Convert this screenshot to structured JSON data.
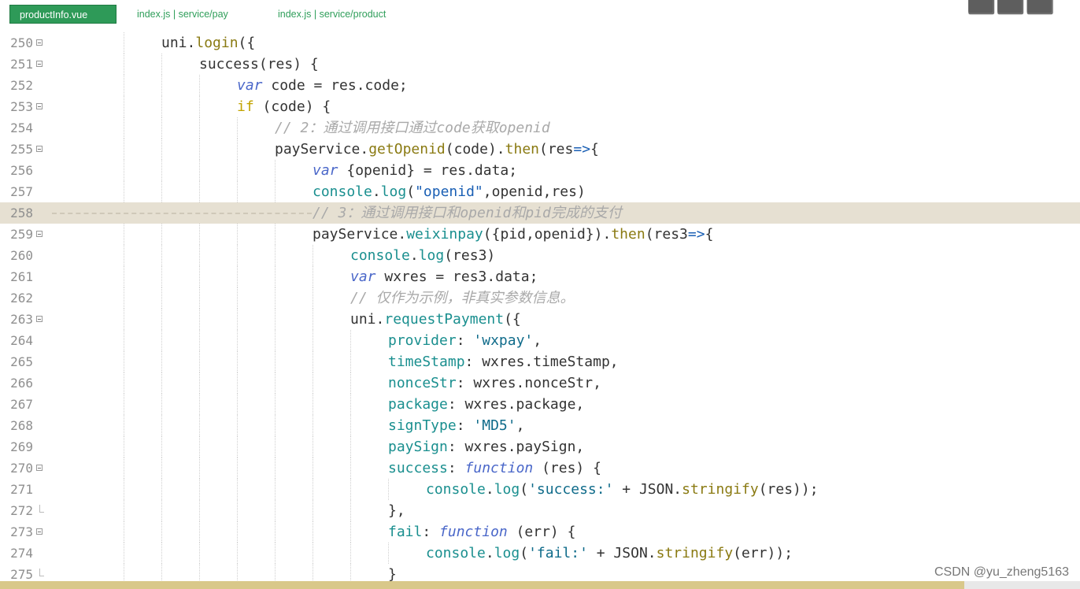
{
  "tabs": [
    {
      "label": "productInfo.vue",
      "active": true
    },
    {
      "label": "index.js | service/pay",
      "active": false
    },
    {
      "label": "index.js | service/product",
      "active": false
    }
  ],
  "watermark": "CSDN @yu_zheng5163",
  "colors": {
    "tab_active": "#2e9a58",
    "highlight_line": "#e6e0d2",
    "keyword": "#4a67c9",
    "property": "#1a8f8f",
    "comment": "#a9a9a9"
  },
  "lines": [
    {
      "n": "250",
      "fold": "open"
    },
    {
      "n": "251",
      "fold": "open"
    },
    {
      "n": "252",
      "fold": "none"
    },
    {
      "n": "253",
      "fold": "open"
    },
    {
      "n": "254",
      "fold": "none"
    },
    {
      "n": "255",
      "fold": "open"
    },
    {
      "n": "256",
      "fold": "none"
    },
    {
      "n": "257",
      "fold": "none"
    },
    {
      "n": "258",
      "fold": "none",
      "highlight": true
    },
    {
      "n": "259",
      "fold": "open"
    },
    {
      "n": "260",
      "fold": "none"
    },
    {
      "n": "261",
      "fold": "none"
    },
    {
      "n": "262",
      "fold": "none"
    },
    {
      "n": "263",
      "fold": "open"
    },
    {
      "n": "264",
      "fold": "none"
    },
    {
      "n": "265",
      "fold": "none"
    },
    {
      "n": "266",
      "fold": "none"
    },
    {
      "n": "267",
      "fold": "none"
    },
    {
      "n": "268",
      "fold": "none"
    },
    {
      "n": "269",
      "fold": "none"
    },
    {
      "n": "270",
      "fold": "open"
    },
    {
      "n": "271",
      "fold": "none"
    },
    {
      "n": "272",
      "fold": "end"
    },
    {
      "n": "273",
      "fold": "open"
    },
    {
      "n": "274",
      "fold": "none"
    },
    {
      "n": "275",
      "fold": "end"
    }
  ],
  "code": {
    "l250": [
      [
        "uni",
        "id"
      ],
      [
        ".",
        "punc"
      ],
      [
        "login",
        "fn"
      ],
      [
        "({",
        "punc"
      ]
    ],
    "l251": [
      [
        "success",
        "id"
      ],
      [
        "(res) {",
        "punc"
      ]
    ],
    "l252": [
      [
        "var",
        "kw"
      ],
      [
        " code = res.code;",
        "id"
      ]
    ],
    "l253": [
      [
        "if",
        "kw2"
      ],
      [
        " (code) {",
        "id"
      ]
    ],
    "l254": [
      [
        "// 2：通过调用接口通过code获取openid",
        "cmt"
      ]
    ],
    "l255": [
      [
        "payService",
        "id"
      ],
      [
        ".",
        "punc"
      ],
      [
        "getOpenid",
        "fn"
      ],
      [
        "(code)",
        "id"
      ],
      [
        ".",
        "punc"
      ],
      [
        "then",
        "fn"
      ],
      [
        "(res",
        "id"
      ],
      [
        "=>",
        "op"
      ],
      [
        "{",
        "id"
      ]
    ],
    "l256": [
      [
        "var",
        "kw"
      ],
      [
        " {openid} = res.data;",
        "id"
      ]
    ],
    "l257": [
      [
        "console",
        "prop"
      ],
      [
        ".",
        "punc"
      ],
      [
        "log",
        "prop"
      ],
      [
        "(",
        "id"
      ],
      [
        "\"openid\"",
        "str"
      ],
      [
        ",openid,res)",
        "id"
      ]
    ],
    "l258": [
      [
        "// 3：通过调用接口和openid和pid完成的支付",
        "cmt"
      ]
    ],
    "l259": [
      [
        "payService",
        "id"
      ],
      [
        ".",
        "punc"
      ],
      [
        "weixinpay",
        "prop"
      ],
      [
        "({pid,openid})",
        "id"
      ],
      [
        ".",
        "punc"
      ],
      [
        "then",
        "fn"
      ],
      [
        "(res3",
        "id"
      ],
      [
        "=>",
        "op"
      ],
      [
        "{",
        "id"
      ]
    ],
    "l260": [
      [
        "console",
        "prop"
      ],
      [
        ".",
        "punc"
      ],
      [
        "log",
        "prop"
      ],
      [
        "(res3)",
        "id"
      ]
    ],
    "l261": [
      [
        "var",
        "kw"
      ],
      [
        " wxres = res3.data;",
        "id"
      ]
    ],
    "l262": [
      [
        "// 仅作为示例，非真实参数信息。",
        "cmt"
      ]
    ],
    "l263": [
      [
        "uni",
        "id"
      ],
      [
        ".",
        "punc"
      ],
      [
        "requestPayment",
        "prop"
      ],
      [
        "({",
        "id"
      ]
    ],
    "l264": [
      [
        "provider",
        "prop"
      ],
      [
        ": ",
        "id"
      ],
      [
        "'wxpay'",
        "str2"
      ],
      [
        ",",
        "id"
      ]
    ],
    "l265": [
      [
        "timeStamp",
        "prop"
      ],
      [
        ": wxres.timeStamp,",
        "id"
      ]
    ],
    "l266": [
      [
        "nonceStr",
        "prop"
      ],
      [
        ": wxres.",
        "id"
      ],
      [
        "nonceStr",
        "id"
      ],
      [
        ",",
        "id"
      ]
    ],
    "l267": [
      [
        "package",
        "prop"
      ],
      [
        ": wxres.package,",
        "id"
      ]
    ],
    "l268": [
      [
        "signType",
        "prop"
      ],
      [
        ": ",
        "id"
      ],
      [
        "'MD5'",
        "str2"
      ],
      [
        ",",
        "id"
      ]
    ],
    "l269": [
      [
        "paySign",
        "prop"
      ],
      [
        ": wxres.paySign,",
        "id"
      ]
    ],
    "l270": [
      [
        "success",
        "prop"
      ],
      [
        ": ",
        "id"
      ],
      [
        "function",
        "kw"
      ],
      [
        " (res) {",
        "id"
      ]
    ],
    "l271": [
      [
        "console",
        "prop"
      ],
      [
        ".",
        "punc"
      ],
      [
        "log",
        "prop"
      ],
      [
        "(",
        "id"
      ],
      [
        "'success:'",
        "str2"
      ],
      [
        " + JSON.",
        "id"
      ],
      [
        "stringify",
        "fn"
      ],
      [
        "(res));",
        "id"
      ]
    ],
    "l272": [
      [
        "},",
        "id"
      ]
    ],
    "l273": [
      [
        "fail",
        "prop"
      ],
      [
        ": ",
        "id"
      ],
      [
        "function",
        "kw"
      ],
      [
        " (err) {",
        "id"
      ]
    ],
    "l274": [
      [
        "console",
        "prop"
      ],
      [
        ".",
        "punc"
      ],
      [
        "log",
        "prop"
      ],
      [
        "(",
        "id"
      ],
      [
        "'fail:'",
        "str2"
      ],
      [
        " + JSON.",
        "id"
      ],
      [
        "stringify",
        "fn"
      ],
      [
        "(err));",
        "id"
      ]
    ],
    "l275": [
      [
        "}",
        "id"
      ]
    ]
  }
}
